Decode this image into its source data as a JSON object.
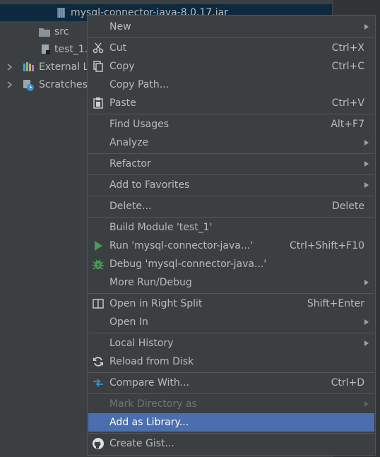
{
  "tree": {
    "jar_file": "mysql-connector-java-8.0.17.jar",
    "src": "src",
    "iml": "test_1.",
    "external": "External L",
    "scratches": "Scratches"
  },
  "menu": [
    {
      "label": "New",
      "submenu": true
    },
    {
      "sep": true
    },
    {
      "label": "Cut",
      "shortcut": "Ctrl+X",
      "icon": "scissors-icon"
    },
    {
      "label": "Copy",
      "shortcut": "Ctrl+C",
      "icon": "copy-icon"
    },
    {
      "label": "Copy Path...",
      "shortcut": ""
    },
    {
      "label": "Paste",
      "shortcut": "Ctrl+V",
      "icon": "clipboard-icon"
    },
    {
      "sep": true
    },
    {
      "label": "Find Usages",
      "shortcut": "Alt+F7"
    },
    {
      "label": "Analyze",
      "submenu": true
    },
    {
      "sep": true
    },
    {
      "label": "Refactor",
      "submenu": true
    },
    {
      "sep": true
    },
    {
      "label": "Add to Favorites",
      "submenu": true
    },
    {
      "sep": true
    },
    {
      "label": "Delete...",
      "shortcut": "Delete"
    },
    {
      "sep": true
    },
    {
      "label": "Build Module 'test_1'",
      "shortcut": ""
    },
    {
      "label": "Run 'mysql-connector-java...'",
      "shortcut": "Ctrl+Shift+F10",
      "icon": "run-icon"
    },
    {
      "label": "Debug 'mysql-connector-java...'",
      "shortcut": "",
      "icon": "debug-icon"
    },
    {
      "label": "More Run/Debug",
      "submenu": true
    },
    {
      "sep": true
    },
    {
      "label": "Open in Right Split",
      "shortcut": "Shift+Enter",
      "icon": "split-icon"
    },
    {
      "label": "Open In",
      "submenu": true
    },
    {
      "sep": true
    },
    {
      "label": "Local History",
      "submenu": true
    },
    {
      "label": "Reload from Disk",
      "shortcut": "",
      "icon": "reload-icon"
    },
    {
      "sep": true
    },
    {
      "label": "Compare With...",
      "shortcut": "Ctrl+D",
      "icon": "compare-icon"
    },
    {
      "sep": true
    },
    {
      "label": "Mark Directory as",
      "submenu": true,
      "disabled": true
    },
    {
      "label": "Add as Library...",
      "shortcut": "",
      "highlighted": true
    },
    {
      "sep": true
    },
    {
      "label": "Create Gist...",
      "shortcut": "",
      "icon": "github-icon"
    }
  ],
  "colors": {
    "highlight": "#4b6eaf",
    "run": "#499c54",
    "debug": "#499c54",
    "folder": "#87939a",
    "compare": "#3592c4"
  }
}
